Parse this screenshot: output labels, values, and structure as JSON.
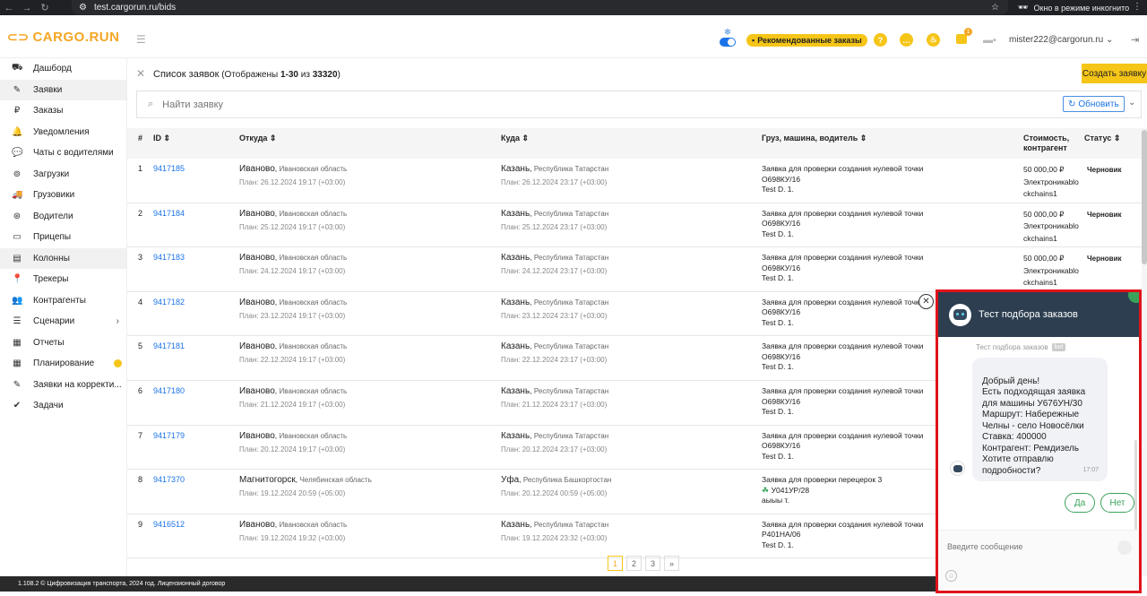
{
  "browser": {
    "url": "test.cargorun.ru/bids",
    "incognito_label": "Окно в режиме инкогнито"
  },
  "header": {
    "logo_text": "CARGO.RUN",
    "recommended_label": "Рекомендованные заказы",
    "notification_count": "1",
    "user_email": "mister222@cargorun.ru"
  },
  "sidebar": {
    "items": [
      {
        "label": "Дашборд",
        "icon": "dashboard-icon",
        "active": false
      },
      {
        "label": "Заявки",
        "icon": "bids-icon",
        "active": true
      },
      {
        "label": "Заказы",
        "icon": "ruble-icon",
        "active": false
      },
      {
        "label": "Уведомления",
        "icon": "bell-icon",
        "active": false
      },
      {
        "label": "Чаты с водителями",
        "icon": "chat-icon",
        "active": false
      },
      {
        "label": "Загрузки",
        "icon": "loading-icon",
        "active": false
      },
      {
        "label": "Грузовики",
        "icon": "truck-icon",
        "active": false
      },
      {
        "label": "Водители",
        "icon": "steering-wheel-icon",
        "active": false
      },
      {
        "label": "Прицепы",
        "icon": "trailer-icon",
        "active": false
      },
      {
        "label": "Колонны",
        "icon": "convoy-icon",
        "active": true
      },
      {
        "label": "Трекеры",
        "icon": "pin-icon",
        "active": false
      },
      {
        "label": "Контрагенты",
        "icon": "contractors-icon",
        "active": false
      },
      {
        "label": "Сценарии",
        "icon": "list-icon",
        "active": false
      },
      {
        "label": "Отчеты",
        "icon": "report-icon",
        "active": false
      },
      {
        "label": "Планирование",
        "icon": "calendar-icon",
        "active": false
      },
      {
        "label": "Заявки на корректи...",
        "icon": "correction-icon",
        "active": false
      },
      {
        "label": "Задачи",
        "icon": "check-icon",
        "active": false
      }
    ]
  },
  "list": {
    "title_prefix": "Список заявок",
    "title_shown": "(Отображены",
    "range": "1-30",
    "of": "из",
    "total": "33320",
    "close_paren": ")",
    "create_label": "Создать заявку",
    "search_placeholder": "Найти заявку",
    "refresh_label": "Обновить"
  },
  "table": {
    "headers": {
      "num": "#",
      "id": "ID",
      "from": "Откуда",
      "to": "Куда",
      "cargo": "Груз, машина, водитель",
      "cost": "Стоимость, контрагент",
      "status": "Статус"
    },
    "rows": [
      {
        "num": "1",
        "id": "9417185",
        "from_city": "Иваново",
        "from_region": "Ивановская область",
        "from_plan": "План: 26.12.2024 19:17 (+03:00)",
        "to_city": "Казань",
        "to_region": "Республика Татарстан",
        "to_plan": "План: 26.12.2024 23:17 (+03:00)",
        "cargo": "Заявка для проверки создания нулевой точки",
        "truck": "О698КУ/16",
        "driver": "Test D. 1.",
        "cost": "50 000,00 ₽",
        "contractor": "Электроникablo ckchains1",
        "status": "Черновик"
      },
      {
        "num": "2",
        "id": "9417184",
        "from_city": "Иваново",
        "from_region": "Ивановская область",
        "from_plan": "План: 25.12.2024 19:17 (+03:00)",
        "to_city": "Казань",
        "to_region": "Республика Татарстан",
        "to_plan": "План: 25.12.2024 23:17 (+03:00)",
        "cargo": "Заявка для проверки создания нулевой точки",
        "truck": "О698КУ/16",
        "driver": "Test D. 1.",
        "cost": "50 000,00 ₽",
        "contractor": "Электроникablo ckchains1",
        "status": "Черновик"
      },
      {
        "num": "3",
        "id": "9417183",
        "from_city": "Иваново",
        "from_region": "Ивановская область",
        "from_plan": "План: 24.12.2024 19:17 (+03:00)",
        "to_city": "Казань",
        "to_region": "Республика Татарстан",
        "to_plan": "План: 24.12.2024 23:17 (+03:00)",
        "cargo": "Заявка для проверки создания нулевой точки",
        "truck": "О698КУ/16",
        "driver": "Test D. 1.",
        "cost": "50 000,00 ₽",
        "contractor": "Электроникablo ckchains1",
        "status": "Черновик"
      },
      {
        "num": "4",
        "id": "9417182",
        "from_city": "Иваново",
        "from_region": "Ивановская область",
        "from_plan": "План: 23.12.2024 19:17 (+03:00)",
        "to_city": "Казань",
        "to_region": "Республика Татарстан",
        "to_plan": "План: 23.12.2024 23:17 (+03:00)",
        "cargo": "Заявка для проверки создания нулевой точки",
        "truck": "О698КУ/16",
        "driver": "Test D. 1.",
        "cost": "",
        "contractor": "",
        "status": ""
      },
      {
        "num": "5",
        "id": "9417181",
        "from_city": "Иваново",
        "from_region": "Ивановская область",
        "from_plan": "План: 22.12.2024 19:17 (+03:00)",
        "to_city": "Казань",
        "to_region": "Республика Татарстан",
        "to_plan": "План: 22.12.2024 23:17 (+03:00)",
        "cargo": "Заявка для проверки создания нулевой точки",
        "truck": "О698КУ/16",
        "driver": "Test D. 1.",
        "cost": "",
        "contractor": "",
        "status": ""
      },
      {
        "num": "6",
        "id": "9417180",
        "from_city": "Иваново",
        "from_region": "Ивановская область",
        "from_plan": "План: 21.12.2024 19:17 (+03:00)",
        "to_city": "Казань",
        "to_region": "Республика Татарстан",
        "to_plan": "План: 21.12.2024 23:17 (+03:00)",
        "cargo": "Заявка для проверки создания нулевой точки",
        "truck": "О698КУ/16",
        "driver": "Test D. 1.",
        "cost": "",
        "contractor": "",
        "status": ""
      },
      {
        "num": "7",
        "id": "9417179",
        "from_city": "Иваново",
        "from_region": "Ивановская область",
        "from_plan": "План: 20.12.2024 19:17 (+03:00)",
        "to_city": "Казань",
        "to_region": "Республика Татарстан",
        "to_plan": "План: 20.12.2024 23:17 (+03:00)",
        "cargo": "Заявка для проверки создания нулевой точки",
        "truck": "О698КУ/16",
        "driver": "Test D. 1.",
        "cost": "",
        "contractor": "",
        "status": ""
      },
      {
        "num": "8",
        "id": "9417370",
        "from_city": "Магнитогорск",
        "from_region": "Челябинская область",
        "from_plan": "План: 19.12.2024 20:59 (+05:00)",
        "to_city": "Уфа",
        "to_region": "Республика Башкортостан",
        "to_plan": "План: 20.12.2024 00:59 (+05:00)",
        "cargo": "Заявка для проверки перецерок 3",
        "truck": "У041УР/28",
        "driver": "аыыы т.",
        "cost": "",
        "contractor": "",
        "status": ""
      },
      {
        "num": "9",
        "id": "9416512",
        "from_city": "Иваново",
        "from_region": "Ивановская область",
        "from_plan": "План: 19.12.2024 19:32 (+03:00)",
        "to_city": "Казань",
        "to_region": "Республика Татарстан",
        "to_plan": "План: 19.12.2024 23:32 (+03:00)",
        "cargo": "Заявка для проверки создания нулевой точки",
        "truck": "Р401НА/06",
        "driver": "Test D. 1.",
        "cost": "",
        "contractor": "",
        "status": ""
      }
    ]
  },
  "pagination": {
    "pages": [
      "1",
      "2",
      "3"
    ],
    "next": "»"
  },
  "footer": {
    "text": "1.108.2 © Цифровизация транспорта, 2024 год.  Лицензионный договор"
  },
  "chat": {
    "title": "Тест подбора заказов",
    "sender": "Тест подбора заказов",
    "sender_tag": "bot",
    "message": "Добрый день!\nЕсть подходящая заявка для машины У676УН/30\nМаршрут: Набережные Челны - село Новосёлки\nСтавка: 400000\nКонтрагент: Ремдизель\nХотите отправлю подробности?",
    "time": "17:07",
    "reply_yes": "Да",
    "reply_no": "Нет",
    "input_placeholder": "Введите сообщение"
  },
  "colors": {
    "brand": "#f5c518",
    "link": "#1a73e8",
    "chat_header": "#2c3e50",
    "highlight_border": "#e0131b",
    "reply_green": "#3aa35b"
  }
}
